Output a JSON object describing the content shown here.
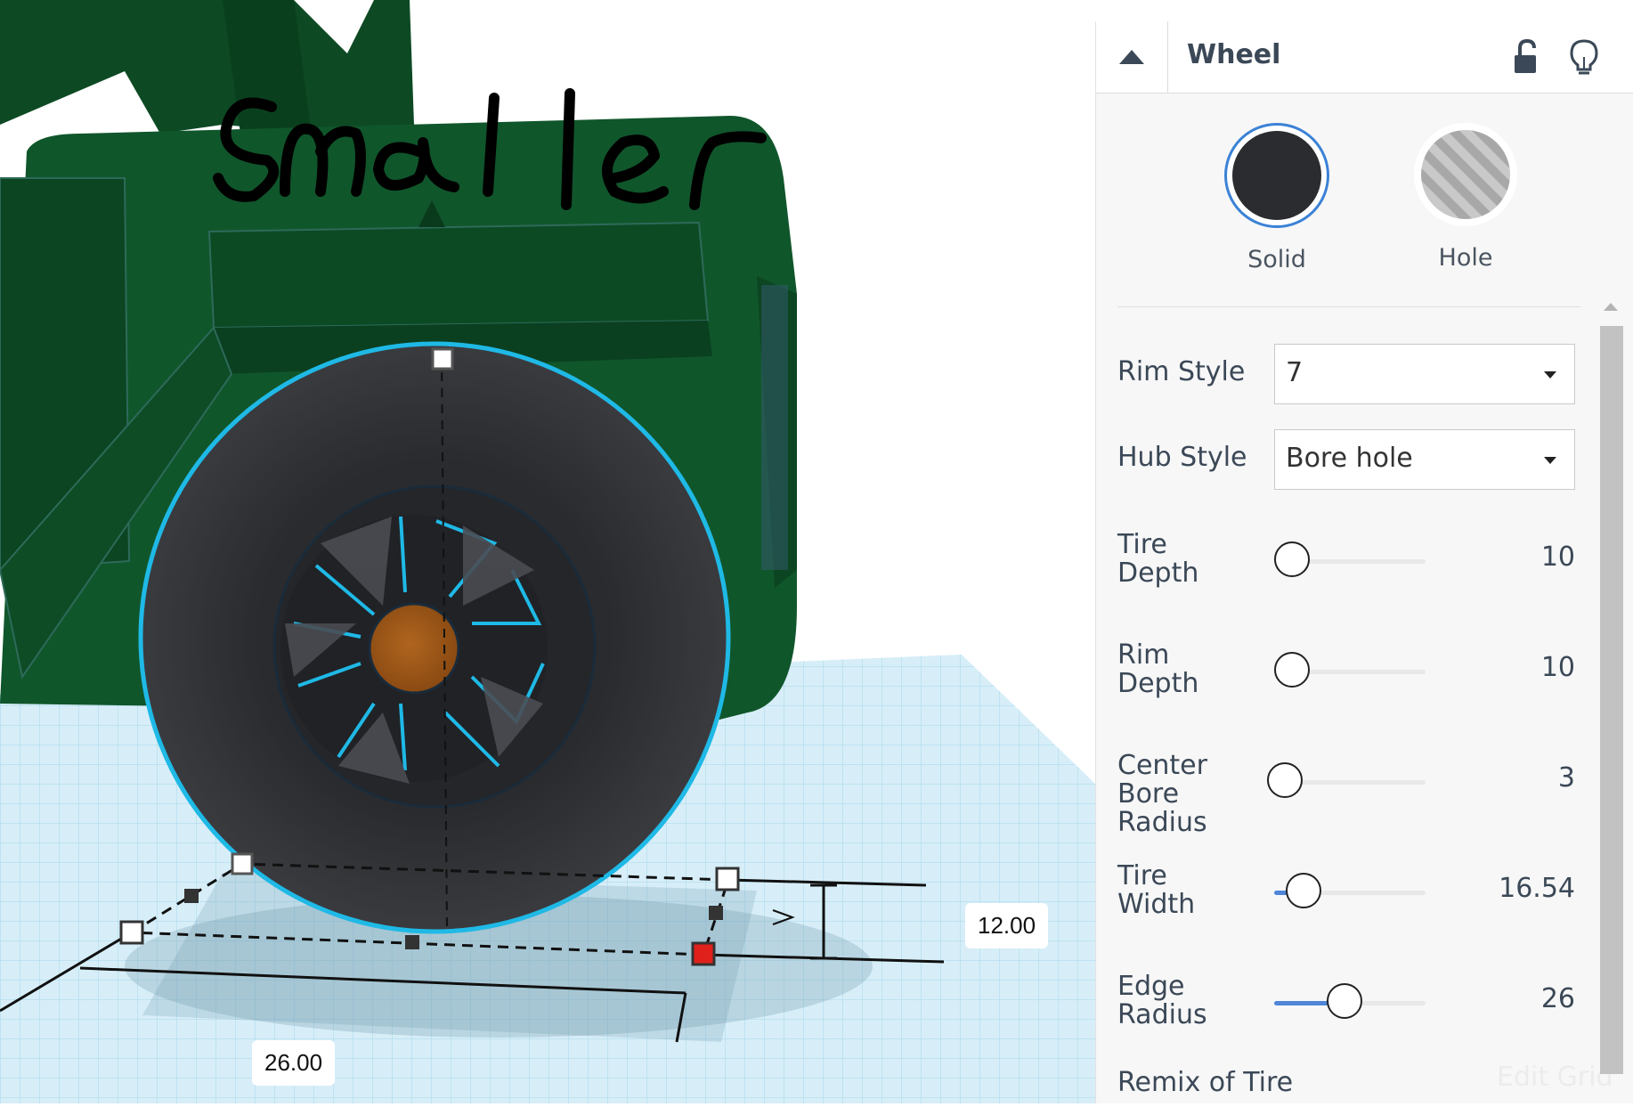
{
  "viewport": {
    "annotation_text": "smaller",
    "dim_height": "12.00",
    "dim_width": "26.00"
  },
  "inspector": {
    "title": "Wheel",
    "solid_label": "Solid",
    "hole_label": "Hole",
    "props": {
      "rim_style_label": "Rim Style",
      "rim_style_value": "7",
      "hub_style_label": "Hub Style",
      "hub_style_value": "Bore hole",
      "tire_depth_label": "Tire\nDepth",
      "tire_depth_value": "10",
      "rim_depth_label": "Rim\nDepth",
      "rim_depth_value": "10",
      "center_bore_label": "Center\nBore\nRadius",
      "center_bore_value": "3",
      "tire_width_label": "Tire\nWidth",
      "tire_width_value": "16.54",
      "edge_radius_label": "Edge\nRadius",
      "edge_radius_value": "26",
      "remix_label": "Remix of Tire"
    },
    "edit_grid": "Edit Grid"
  },
  "slider_levels": {
    "tire_depth": 0.0,
    "rim_depth": 0.0,
    "center_bore": 0.0,
    "tire_width": 0.1,
    "edge_radius": 0.45
  },
  "colors": {
    "body_green": "#0f5229",
    "tire": "#2b2c2f",
    "selection": "#1fb9e6",
    "hub": "#9b5517",
    "grid": "#c8e6f2",
    "accent_blue": "#3b82d6"
  }
}
